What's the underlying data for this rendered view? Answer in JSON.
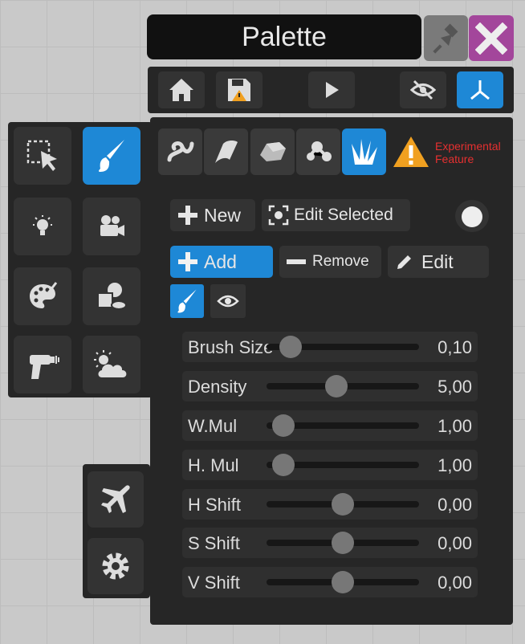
{
  "window": {
    "title": "Palette"
  },
  "warning": {
    "line1": "Experimental",
    "line2": "Feature"
  },
  "actions": {
    "new_label": "New",
    "edit_selected_label": "Edit Selected",
    "add_label": "Add",
    "remove_label": "Remove",
    "edit_label": "Edit"
  },
  "sliders": [
    {
      "label": "Brush Size",
      "value": "0,10",
      "fraction": 0.16
    },
    {
      "label": "Density",
      "value": "5,00",
      "fraction": 0.46
    },
    {
      "label": "W.Mul",
      "value": "1,00",
      "fraction": 0.11
    },
    {
      "label": "H. Mul",
      "value": "1,00",
      "fraction": 0.11
    },
    {
      "label": "H Shift",
      "value": "0,00",
      "fraction": 0.5
    },
    {
      "label": "S Shift",
      "value": "0,00",
      "fraction": 0.5
    },
    {
      "label": "V Shift",
      "value": "0,00",
      "fraction": 0.5
    }
  ],
  "colors": {
    "accent": "#1e88d6",
    "close": "#a3469b",
    "warning_icon": "#f0a020",
    "warning_text": "#e53030"
  },
  "icons": [
    "pin-icon",
    "close-icon",
    "home-icon",
    "save-warning-icon",
    "play-icon",
    "eye-off-icon",
    "axes-icon",
    "select-icon",
    "brush-icon",
    "light-icon",
    "camera-icon",
    "palette-icon",
    "shapes-icon",
    "raygun-icon",
    "weather-icon",
    "plane-icon",
    "gear-icon",
    "curve-icon",
    "ribbon-icon",
    "rock-icon",
    "molecule-icon",
    "grass-icon",
    "warning-icon",
    "plus-icon",
    "target-icon",
    "minus-icon",
    "pencil-icon",
    "eye-icon"
  ]
}
